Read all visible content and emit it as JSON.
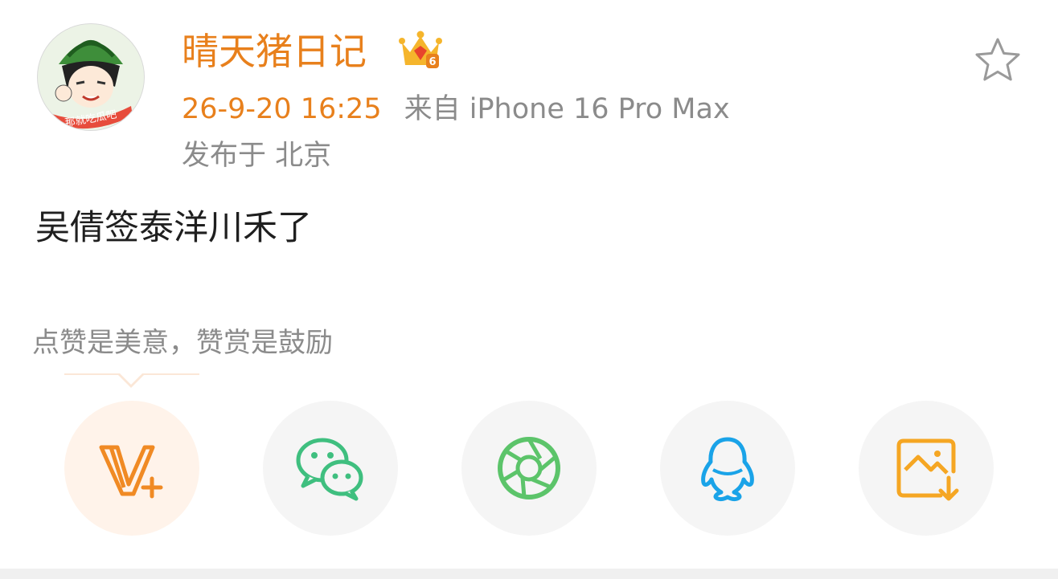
{
  "post": {
    "username": "晴天猪日记",
    "time": "26-9-20 16:25",
    "source": "来自 iPhone 16 Pro Max",
    "location": "发布于 北京",
    "text": "吴倩签泰洋川禾了"
  },
  "avatar_text": "那就吃瓜吧",
  "reward_text": "点赞是美意，赞赏是鼓励",
  "icons": {
    "vip_badge": "crown-icon",
    "favorite": "star-icon",
    "share": [
      "vplus-icon",
      "wechat-icon",
      "moments-icon",
      "qq-icon",
      "save-image-icon"
    ]
  },
  "colors": {
    "accent": "#e8801c",
    "secondary_text": "#8b8b8b",
    "wechat": "#3fbf7f",
    "moments": "#5cc46a",
    "qq": "#1aa3e8",
    "save": "#f5a623"
  }
}
